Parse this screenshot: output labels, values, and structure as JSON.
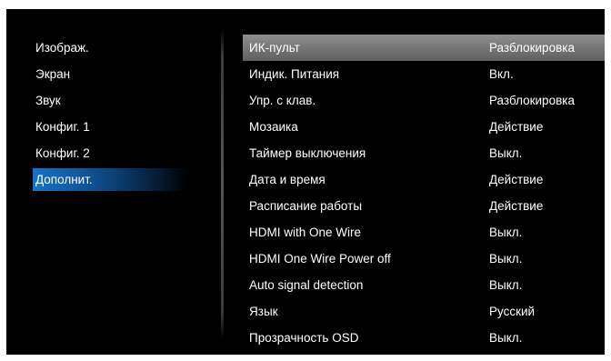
{
  "left_menu": {
    "items": [
      {
        "label": "Изображ."
      },
      {
        "label": "Экран"
      },
      {
        "label": "Звук"
      },
      {
        "label": "Конфиг. 1"
      },
      {
        "label": "Конфиг. 2"
      },
      {
        "label": "Дополнит."
      }
    ],
    "selected_index": 5
  },
  "settings": [
    {
      "label": "ИК-пульт",
      "value": "Разблокировка"
    },
    {
      "label": "Индик. Питания",
      "value": "Вкл."
    },
    {
      "label": "Упр. с клав.",
      "value": "Разблокировка"
    },
    {
      "label": "Мозаика",
      "value": "Действие"
    },
    {
      "label": "Таймер выключения",
      "value": "Выкл."
    },
    {
      "label": "Дата и время",
      "value": "Действие"
    },
    {
      "label": "Расписание работы",
      "value": "Действие"
    },
    {
      "label": "HDMI with One Wire",
      "value": "Выкл."
    },
    {
      "label": "HDMI One Wire Power off",
      "value": "Выкл."
    },
    {
      "label": "Auto signal detection",
      "value": "Выкл."
    },
    {
      "label": "Язык",
      "value": "Русский"
    },
    {
      "label": "Прозрачность OSD",
      "value": "Выкл."
    }
  ],
  "highlighted_index": 0,
  "colors": {
    "background": "#000000",
    "text": "#ffffff",
    "selected_menu_accent": "#1673c8",
    "highlight_row": "#8f8f8f"
  }
}
